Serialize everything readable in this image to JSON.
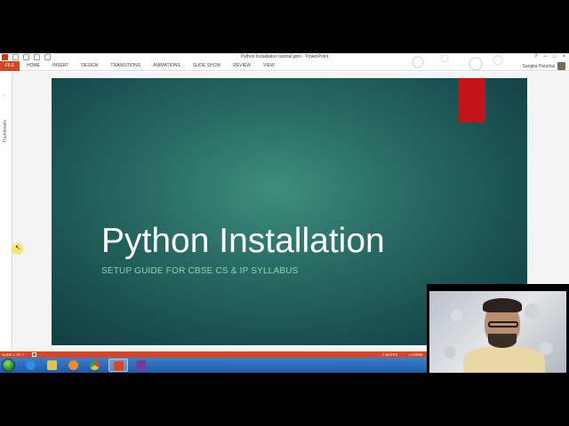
{
  "window": {
    "title": "Python Installation tutorial.pptx - PowerPoint",
    "controls": [
      "?",
      "–",
      "□",
      "×"
    ]
  },
  "ribbon": {
    "file_label": "FILE",
    "tabs": [
      "HOME",
      "INSERT",
      "DESIGN",
      "TRANSITIONS",
      "ANIMATIONS",
      "SLIDE SHOW",
      "REVIEW",
      "VIEW"
    ],
    "user_name": "Sangita Panchal"
  },
  "thumbnails": {
    "label": "Thumbnails"
  },
  "slide": {
    "title": "Python Installation",
    "subtitle": "SETUP GUIDE FOR CBSE CS & IP SYLLABUS",
    "accent_color": "#c3141b"
  },
  "statusbar": {
    "slide_count": "SLIDE 1 OF 7",
    "notes": "NOTES",
    "comments": "COMM"
  },
  "taskbar": {
    "items": [
      {
        "icon": "internet-explorer-icon",
        "color": "#2a8fe0"
      },
      {
        "icon": "file-explorer-icon",
        "color": "#e8c14a"
      },
      {
        "icon": "media-player-icon",
        "color": "#f08a24"
      },
      {
        "icon": "chrome-icon",
        "color": "#d8443a"
      },
      {
        "icon": "powerpoint-icon",
        "color": "#d24726"
      },
      {
        "icon": "recorder-icon",
        "color": "#7a3b8f"
      }
    ]
  },
  "colors": {
    "brand": "#d24726",
    "slide_bg": "#276a63",
    "subtitle": "#8fd4ac"
  }
}
